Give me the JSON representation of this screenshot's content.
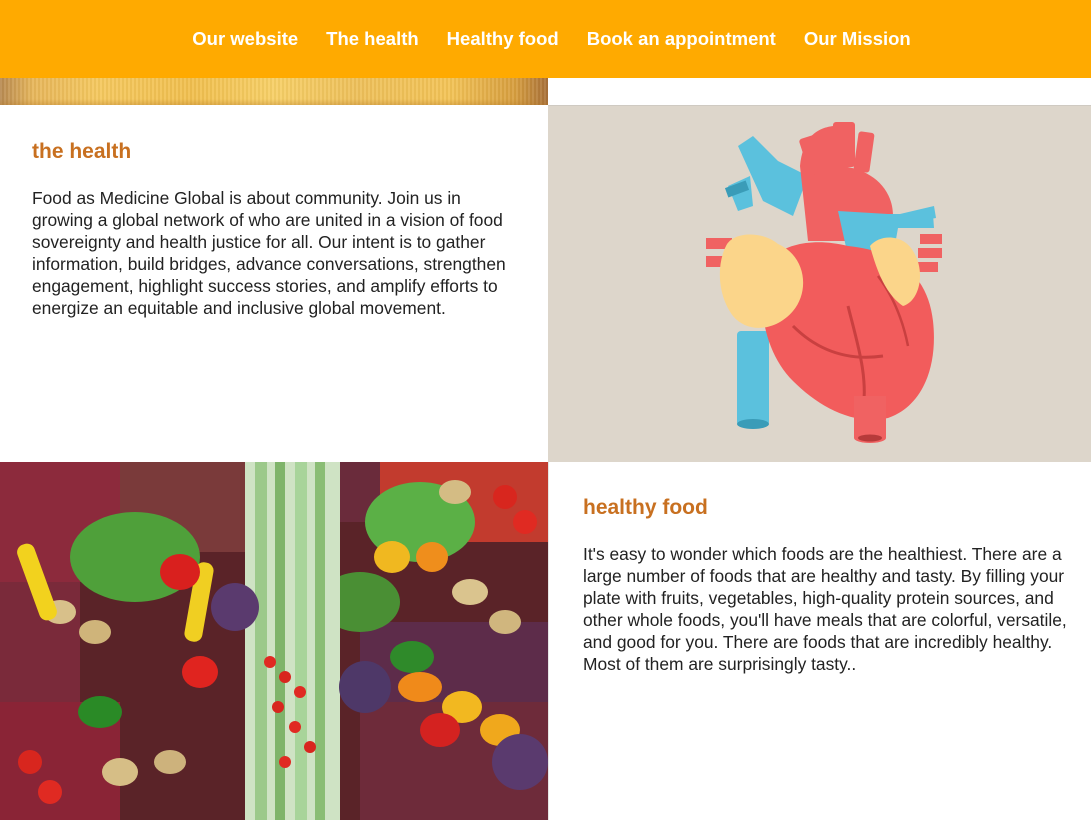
{
  "nav": {
    "items": [
      {
        "label": "Our website"
      },
      {
        "label": "The health"
      },
      {
        "label": "Healthy food"
      },
      {
        "label": "Book an appointment"
      },
      {
        "label": "Our Mission"
      }
    ]
  },
  "section_health": {
    "heading": "the health",
    "body": "Food as Medicine Global is about community. Join us in growing a global network of who are united in a vision of food sovereignty and health justice for all. Our intent is to gather information, build bridges, advance conversations, strengthen engagement, highlight success stories, and amplify efforts to energize an equitable and inclusive global movement."
  },
  "section_food": {
    "heading": "healthy food",
    "body": "It's easy to wonder which foods are the healthiest. There are a large number of foods that are healthy and tasty. By filling your plate with fruits, vegetables, high-quality protein sources, and other whole foods, you'll have meals that are colorful, versatile, and good for you. There are foods that are incredibly healthy. Most of them are surprisingly tasty.."
  },
  "colors": {
    "nav_bar": "#ffaa00",
    "heading": "#c87020",
    "heart_bg": "#ddd6cb"
  }
}
